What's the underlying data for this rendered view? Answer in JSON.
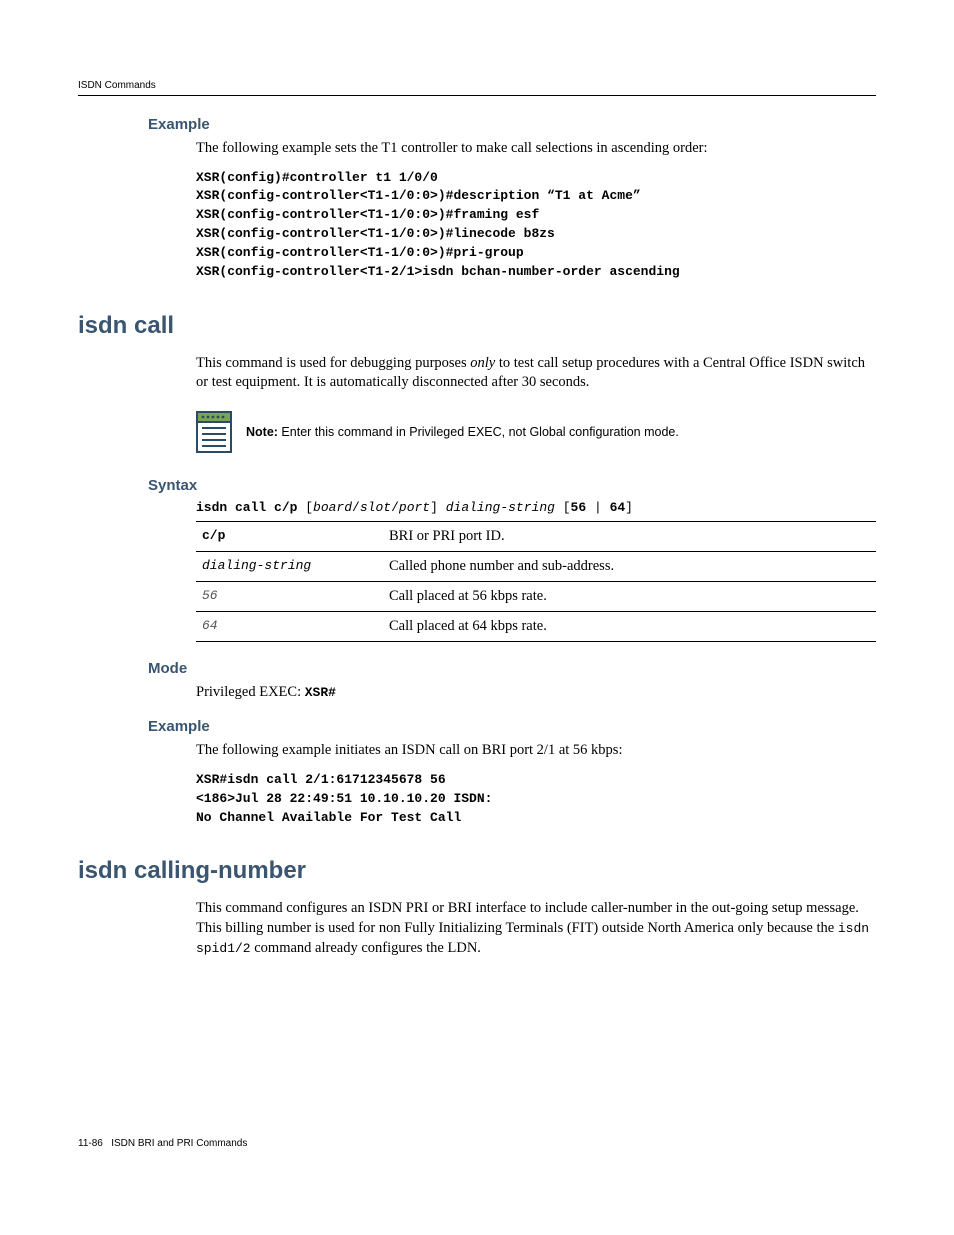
{
  "header": {
    "running": "ISDN Commands"
  },
  "s1": {
    "title": "Example",
    "intro": "The following example sets the T1 controller to make call selections in ascending order:",
    "code": "XSR(config)#controller t1 1/0/0\nXSR(config-controller<T1-1/0:0>)#description “T1 at Acme”\nXSR(config-controller<T1-1/0:0>)#framing esf\nXSR(config-controller<T1-1/0:0>)#linecode b8zs\nXSR(config-controller<T1-1/0:0>)#pri-group\nXSR(config-controller<T1-2/1>isdn bchan-number-order ascending"
  },
  "cmd1": {
    "title": "isdn call",
    "desc_a": "This command is used for debugging purposes ",
    "desc_em": "only",
    "desc_b": " to test call setup procedures with a Central Office ISDN switch or test equipment. It is automatically disconnected after 30 seconds.",
    "note_label": "Note:",
    "note_text": " Enter this command in Privileged EXEC, not Global configuration mode.",
    "syntax_title": "Syntax",
    "syntax": {
      "p1": "isdn call c/p",
      "p2": " [",
      "p3": "board",
      "p4": "/",
      "p5": "slot",
      "p6": "/",
      "p7": "port",
      "p8": "] ",
      "p9": "dialing-string",
      "p10": " [",
      "p11": "56",
      "p12": " | ",
      "p13": "64",
      "p14": "]"
    },
    "params": [
      {
        "k": "c/p",
        "v": "BRI or PRI port ID."
      },
      {
        "k": "dialing-string",
        "v": "Called phone number and sub-address."
      },
      {
        "k": "56",
        "v": "Call placed at 56 kbps rate."
      },
      {
        "k": "64",
        "v": "Call placed at 64 kbps rate."
      }
    ],
    "mode_title": "Mode",
    "mode_text": "Privileged EXEC: ",
    "mode_code": "XSR#",
    "ex_title": "Example",
    "ex_intro": "The following example initiates an ISDN call on BRI port 2/1 at 56 kbps:",
    "ex_code": "XSR#isdn call 2/1:61712345678 56\n<186>Jul 28 22:49:51 10.10.10.20 ISDN:\nNo Channel Available For Test Call"
  },
  "cmd2": {
    "title": "isdn calling-number",
    "desc_a": "This command configures an ISDN PRI or BRI interface to include caller-number in the out-going setup message. This billing number is used for non Fully Initializing Terminals (FIT) outside North America only because the ",
    "desc_code": "isdn spid1/2",
    "desc_b": " command already configures the LDN."
  },
  "footer": {
    "page": "11-86",
    "label": "ISDN BRI and PRI Commands"
  }
}
